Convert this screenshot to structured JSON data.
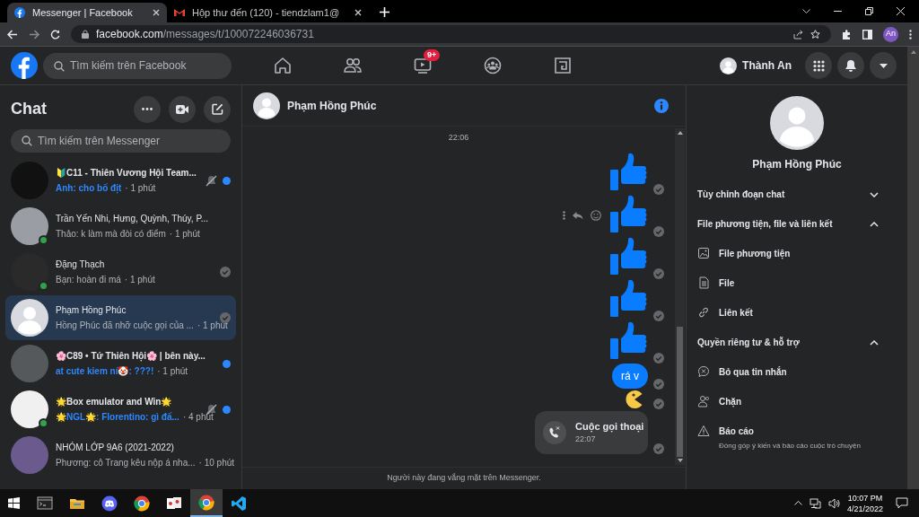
{
  "browser": {
    "tabs": [
      {
        "kind": "facebook",
        "title": "Messenger | Facebook",
        "selected": true
      },
      {
        "kind": "gmail",
        "title": "Hộp thư đến (120) - tiendzlam1@",
        "selected": false
      }
    ],
    "url_host": "facebook.com",
    "url_path": "/messages/t/100072246036731",
    "profile": "An"
  },
  "header": {
    "search_placeholder": "Tìm kiếm trên Facebook",
    "nav": [
      {
        "kind": "home"
      },
      {
        "kind": "friends"
      },
      {
        "kind": "watch",
        "badge": "9+"
      },
      {
        "kind": "groups"
      },
      {
        "kind": "gaming"
      }
    ],
    "user": "Thành An"
  },
  "chats": {
    "title": "Chat",
    "search_placeholder": "Tìm kiếm trên Messenger",
    "items": [
      {
        "name": "🔰C11 - Thiên Vương Hội Team...",
        "preview": "Anh: cho bố địt",
        "time": "· 1 phút",
        "unread": true,
        "muted": true,
        "seen": false,
        "online": false,
        "selected": false
      },
      {
        "name": "Trần Yến Nhi, Hưng, Quỳnh, Thúy, P...",
        "preview": "Thảo: k làm mà đòi có điểm",
        "time": "· 1 phút",
        "unread": false,
        "muted": false,
        "seen": false,
        "online": true,
        "selected": false
      },
      {
        "name": "Đặng Thạch",
        "preview": "Bạn: hoàn đi má",
        "time": "· 1 phút",
        "unread": false,
        "muted": false,
        "seen": true,
        "online": true,
        "selected": false
      },
      {
        "name": "Phạm Hồng Phúc",
        "preview": "Hồng Phúc đã nhỡ cuộc gọi của ...",
        "time": "· 1 phút",
        "unread": false,
        "muted": false,
        "seen": true,
        "online": false,
        "selected": true
      },
      {
        "name": "🌸C89 • Tứ Thiên Hội🌸 | bên này...",
        "preview": "at cute kiem ní🤡: ???!",
        "time": "· 1 phút",
        "unread": true,
        "muted": false,
        "seen": false,
        "online": false,
        "selected": false
      },
      {
        "name": "🌟Box emulator and Win🌟",
        "preview": "🌟NGL🌟: Florentino: gì đấ...",
        "time": "· 4 phút",
        "unread": true,
        "muted": true,
        "seen": false,
        "online": true,
        "selected": false
      },
      {
        "name": "NHÓM LỚP 9A6 (2021-2022)",
        "preview": "Phương: cô Trang kêu nộp á nha...",
        "time": "· 10 phút",
        "unread": false,
        "muted": false,
        "seen": false,
        "online": false,
        "selected": false
      }
    ]
  },
  "conversation": {
    "name": "Phạm Hồng Phúc",
    "timestamp": "22:06",
    "messages": [
      {
        "kind": "like",
        "hovered": false
      },
      {
        "kind": "like",
        "hovered": true
      },
      {
        "kind": "like",
        "hovered": false
      },
      {
        "kind": "like",
        "hovered": false
      },
      {
        "kind": "like",
        "hovered": false
      },
      {
        "kind": "text",
        "text": "rá v",
        "hovered": false
      },
      {
        "kind": "sticker",
        "hovered": false
      },
      {
        "kind": "call",
        "title": "Cuộc gọi thoại",
        "time": "22:07",
        "hovered": false
      }
    ],
    "footer": "Người này đang vắng mặt trên Messenger."
  },
  "details": {
    "name": "Phạm Hồng Phúc",
    "sections": [
      {
        "title": "Tùy chỉnh đoạn chat",
        "expanded": false
      },
      {
        "title": "File phương tiện, file và liên kết",
        "expanded": true,
        "items": [
          {
            "kind": "media",
            "label": "File phương tiện"
          },
          {
            "kind": "file",
            "label": "File"
          },
          {
            "kind": "link",
            "label": "Liên kết"
          }
        ]
      },
      {
        "title": "Quyền riêng tư & hỗ trợ",
        "expanded": true,
        "items": [
          {
            "kind": "ignore",
            "label": "Bỏ qua tin nhắn"
          },
          {
            "kind": "block",
            "label": "Chặn"
          },
          {
            "kind": "report",
            "label": "Báo cáo",
            "description": "Đóng góp ý kiến và báo cáo cuộc trò chuyện"
          }
        ]
      }
    ]
  },
  "taskbar": {
    "apps": [
      {
        "kind": "terminal",
        "selected": false
      },
      {
        "kind": "folder",
        "selected": false
      },
      {
        "kind": "discord",
        "selected": false
      },
      {
        "kind": "chrome",
        "selected": false
      },
      {
        "kind": "cards",
        "selected": false
      },
      {
        "kind": "chrome",
        "selected": true
      },
      {
        "kind": "vscode",
        "selected": false
      }
    ],
    "time": "10:07 PM",
    "date": "4/21/2022"
  }
}
